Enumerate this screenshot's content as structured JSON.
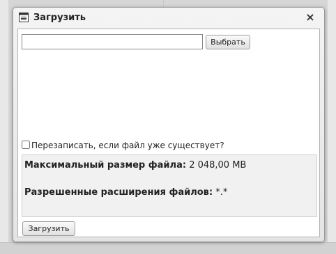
{
  "dialog": {
    "title": "Загрузить",
    "title_icon": "document-list-icon",
    "close_label": "×"
  },
  "file_picker": {
    "value": "",
    "placeholder": "",
    "browse_label": "Выбрать"
  },
  "overwrite": {
    "label": "Перезаписать, если файл уже существует?",
    "checked": false
  },
  "info": {
    "max_size_label": "Максимальный размер файла:",
    "max_size_value": "2 048,00 MB",
    "extensions_label": "Разрешенные расширения файлов:",
    "extensions_value": "*.*"
  },
  "upload_label": "Загрузить"
}
